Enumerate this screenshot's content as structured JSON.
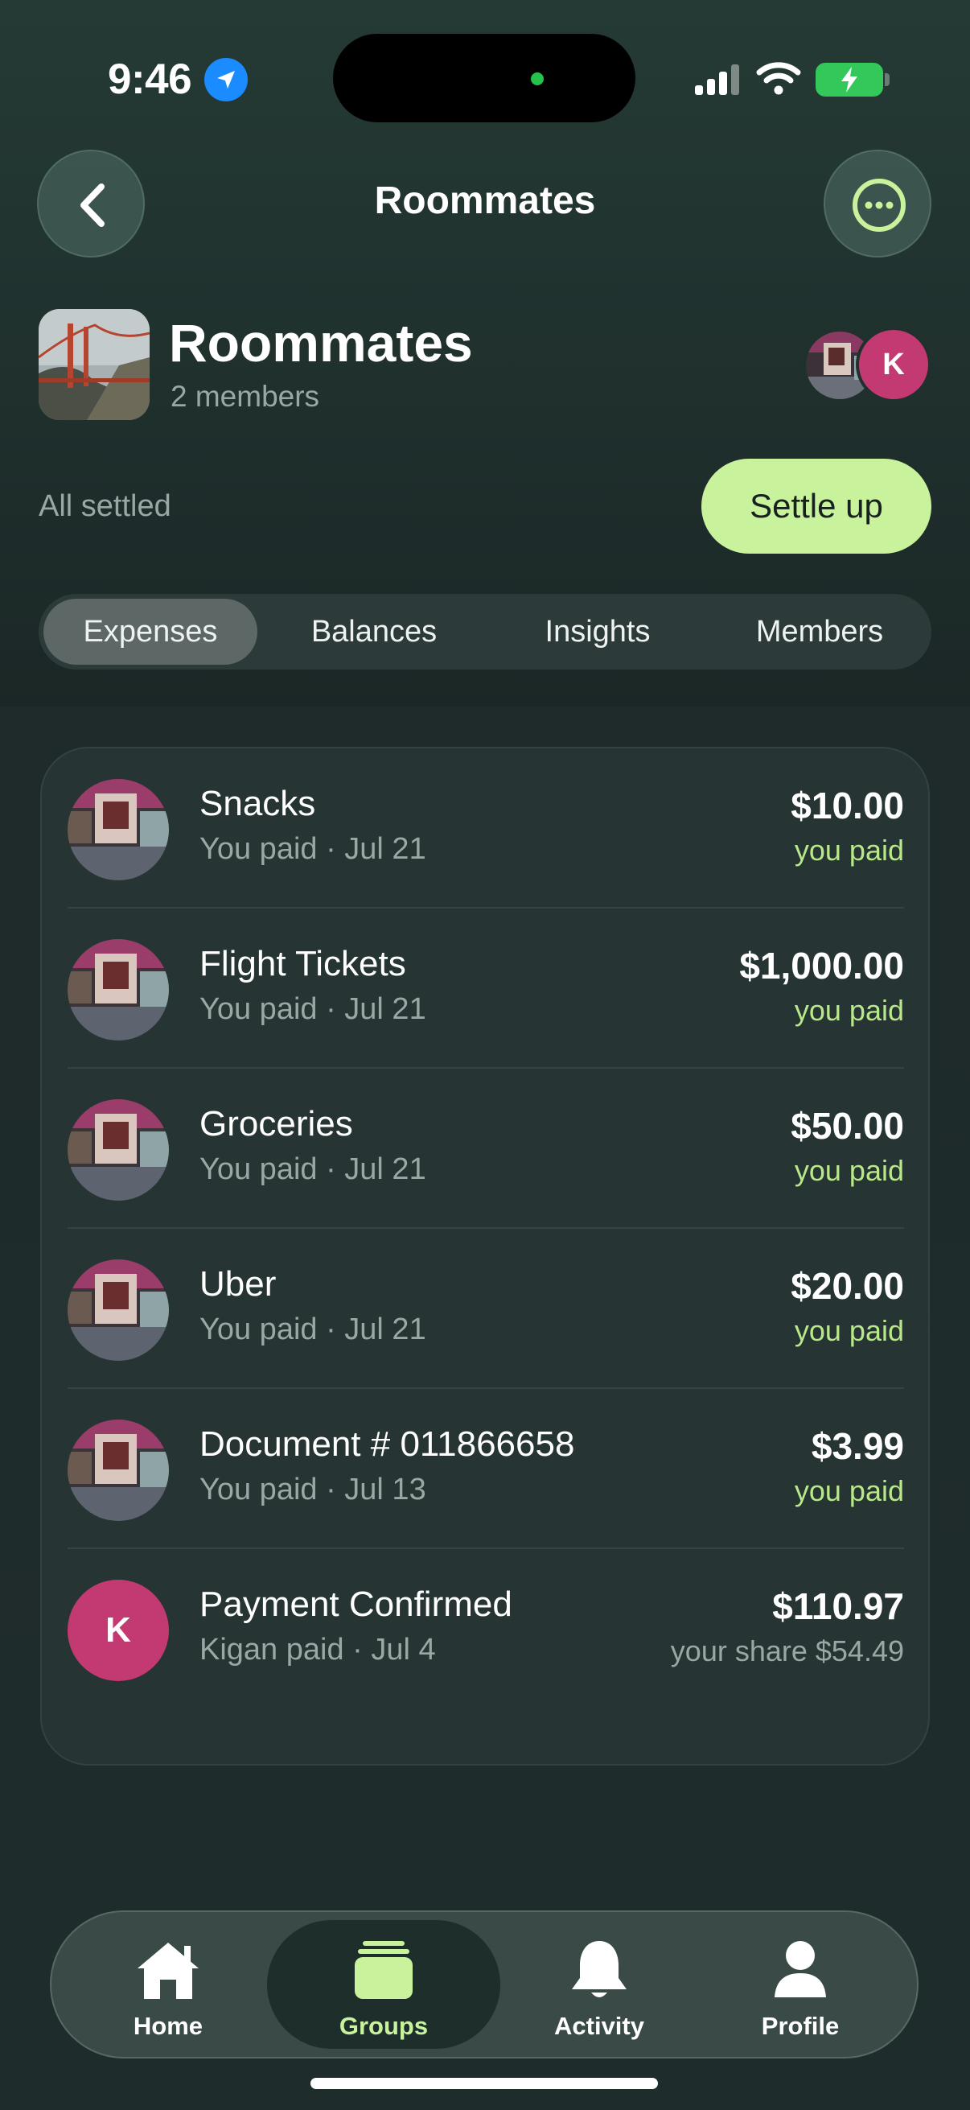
{
  "status_bar": {
    "time": "9:46"
  },
  "nav": {
    "title": "Roommates"
  },
  "group": {
    "name": "Roommates",
    "members": "2 members",
    "member_initial": "K"
  },
  "summary": {
    "status": "All settled",
    "settle_label": "Settle up"
  },
  "tabs": [
    {
      "label": "Expenses",
      "active": true
    },
    {
      "label": "Balances",
      "active": false
    },
    {
      "label": "Insights",
      "active": false
    },
    {
      "label": "Members",
      "active": false
    }
  ],
  "expenses": [
    {
      "title": "Snacks",
      "subtitle": "You paid · Jul 21",
      "amount": "$10.00",
      "note": "you paid",
      "avatar": "photo"
    },
    {
      "title": "Flight Tickets",
      "subtitle": "You paid · Jul 21",
      "amount": "$1,000.00",
      "note": "you paid",
      "avatar": "photo"
    },
    {
      "title": "Groceries",
      "subtitle": "You paid · Jul 21",
      "amount": "$50.00",
      "note": "you paid",
      "avatar": "photo"
    },
    {
      "title": "Uber",
      "subtitle": "You paid · Jul 21",
      "amount": "$20.00",
      "note": "you paid",
      "avatar": "photo"
    },
    {
      "title": "Document # 011866658",
      "subtitle": "You paid · Jul 13",
      "amount": "$3.99",
      "note": "you paid",
      "avatar": "photo"
    },
    {
      "title": "Payment Confirmed",
      "subtitle": "Kigan paid · Jul 4",
      "amount": "$110.97",
      "note": "your share $54.49",
      "avatar": "K"
    }
  ],
  "tabbar": [
    {
      "label": "Home",
      "icon": "house-icon",
      "active": false
    },
    {
      "label": "Groups",
      "icon": "stack-icon",
      "active": true
    },
    {
      "label": "Activity",
      "icon": "bell-icon",
      "active": false
    },
    {
      "label": "Profile",
      "icon": "person-icon",
      "active": false
    }
  ],
  "colors": {
    "accent": "#c9f29c",
    "positive": "#b8e88a",
    "avatar_k": "#c23a71",
    "background": "#1e2a29"
  }
}
